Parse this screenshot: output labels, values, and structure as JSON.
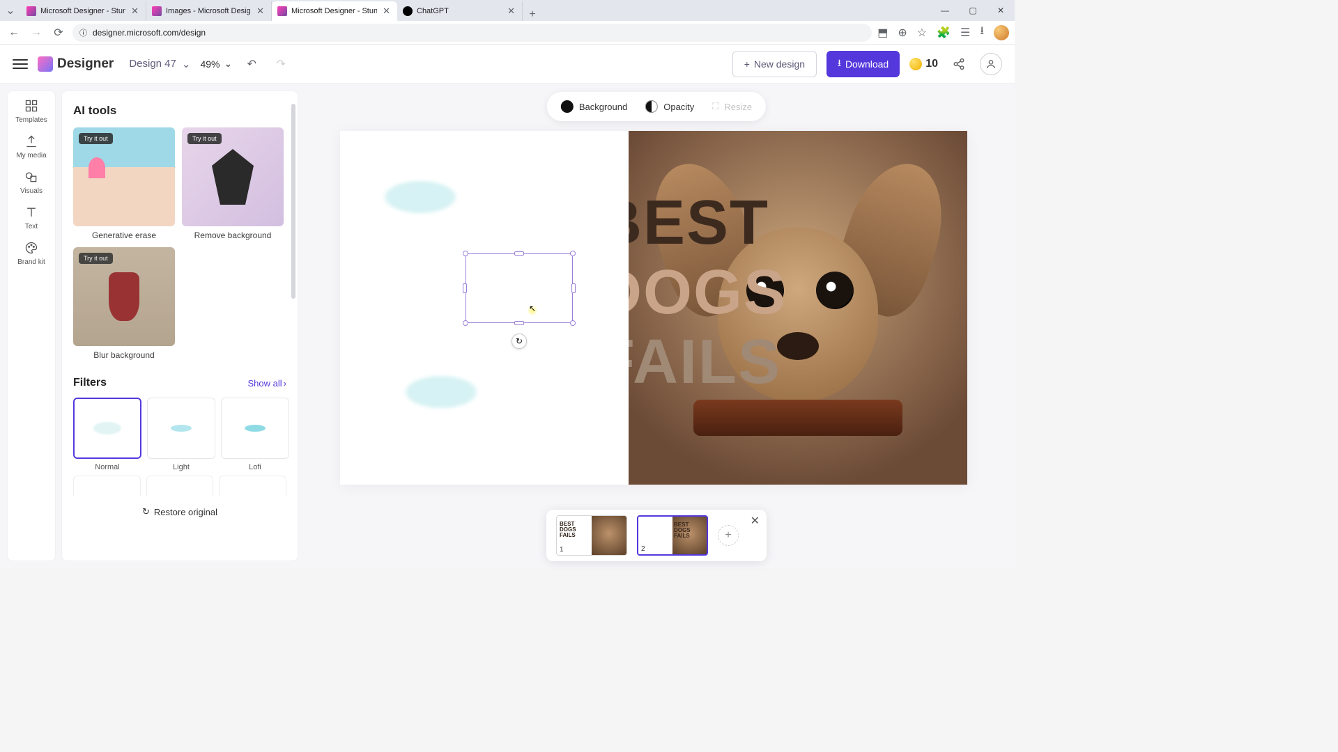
{
  "browser": {
    "tabs": [
      {
        "title": "Microsoft Designer - Stunning",
        "favicon": "linear-gradient(135deg,#ff3eb5,#764ba2)"
      },
      {
        "title": "Images - Microsoft Designer",
        "favicon": "linear-gradient(135deg,#ff3eb5,#764ba2)"
      },
      {
        "title": "Microsoft Designer - Stunning",
        "favicon": "linear-gradient(135deg,#ff3eb5,#764ba2)"
      },
      {
        "title": "ChatGPT",
        "favicon": "#000"
      }
    ],
    "active_tab": 2,
    "url": "designer.microsoft.com/design"
  },
  "header": {
    "app_name": "Designer",
    "design_name": "Design 47",
    "zoom": "49%",
    "new_design_label": "New design",
    "download_label": "Download",
    "credits": "10"
  },
  "rail": {
    "items": [
      "Templates",
      "My media",
      "Visuals",
      "Text",
      "Brand kit"
    ]
  },
  "sidepanel": {
    "ai_tools_title": "AI tools",
    "try_badge": "Try it out",
    "tools": [
      {
        "label": "Generative erase"
      },
      {
        "label": "Remove background"
      },
      {
        "label": "Blur background"
      }
    ],
    "filters_title": "Filters",
    "show_all": "Show all",
    "filters": [
      {
        "label": "Normal"
      },
      {
        "label": "Light"
      },
      {
        "label": "Lofi"
      }
    ],
    "selected_filter": 0,
    "restore_label": "Restore original"
  },
  "floatbar": {
    "background": "Background",
    "opacity": "Opacity",
    "resize": "Resize"
  },
  "canvas": {
    "text_lines": [
      "BEST",
      "DOGS",
      "FAILS"
    ]
  },
  "pagetray": {
    "pages": [
      {
        "num": "1"
      },
      {
        "num": "2"
      }
    ],
    "selected": 1
  }
}
